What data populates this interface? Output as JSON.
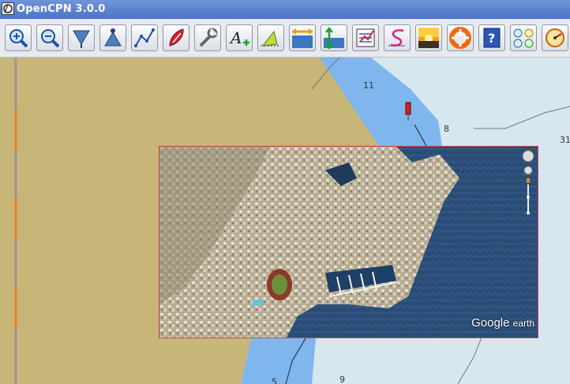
{
  "window": {
    "title": "OpenCPN 3.0.0"
  },
  "toolbar": {
    "tools": [
      {
        "icon": "zoom-in-icon"
      },
      {
        "icon": "zoom-out-icon"
      },
      {
        "icon": "scale-down-icon"
      },
      {
        "icon": "scale-up-icon"
      },
      {
        "icon": "route-icon"
      },
      {
        "icon": "ship-icon"
      },
      {
        "icon": "settings-wrench-icon"
      },
      {
        "icon": "text-add-icon"
      },
      {
        "icon": "ais-icon"
      },
      {
        "icon": "tide-icon"
      },
      {
        "icon": "current-icon"
      },
      {
        "icon": "route-manager-icon"
      },
      {
        "icon": "track-icon"
      },
      {
        "icon": "sunset-icon"
      },
      {
        "icon": "lifebuoy-icon"
      },
      {
        "icon": "help-icon"
      },
      {
        "icon": "dashboard-icon"
      },
      {
        "icon": "plugin-icon"
      }
    ]
  },
  "map": {
    "soundings": [
      "11",
      "8",
      "31",
      "5",
      "9"
    ],
    "overlay": {
      "brand_main": "Google",
      "brand_sub": "earth"
    }
  },
  "colors": {
    "land": "#c8b578",
    "shallow_water": "#7fb6ee",
    "deep_water": "#d6e7ef",
    "overlay_border": "#d04050"
  }
}
